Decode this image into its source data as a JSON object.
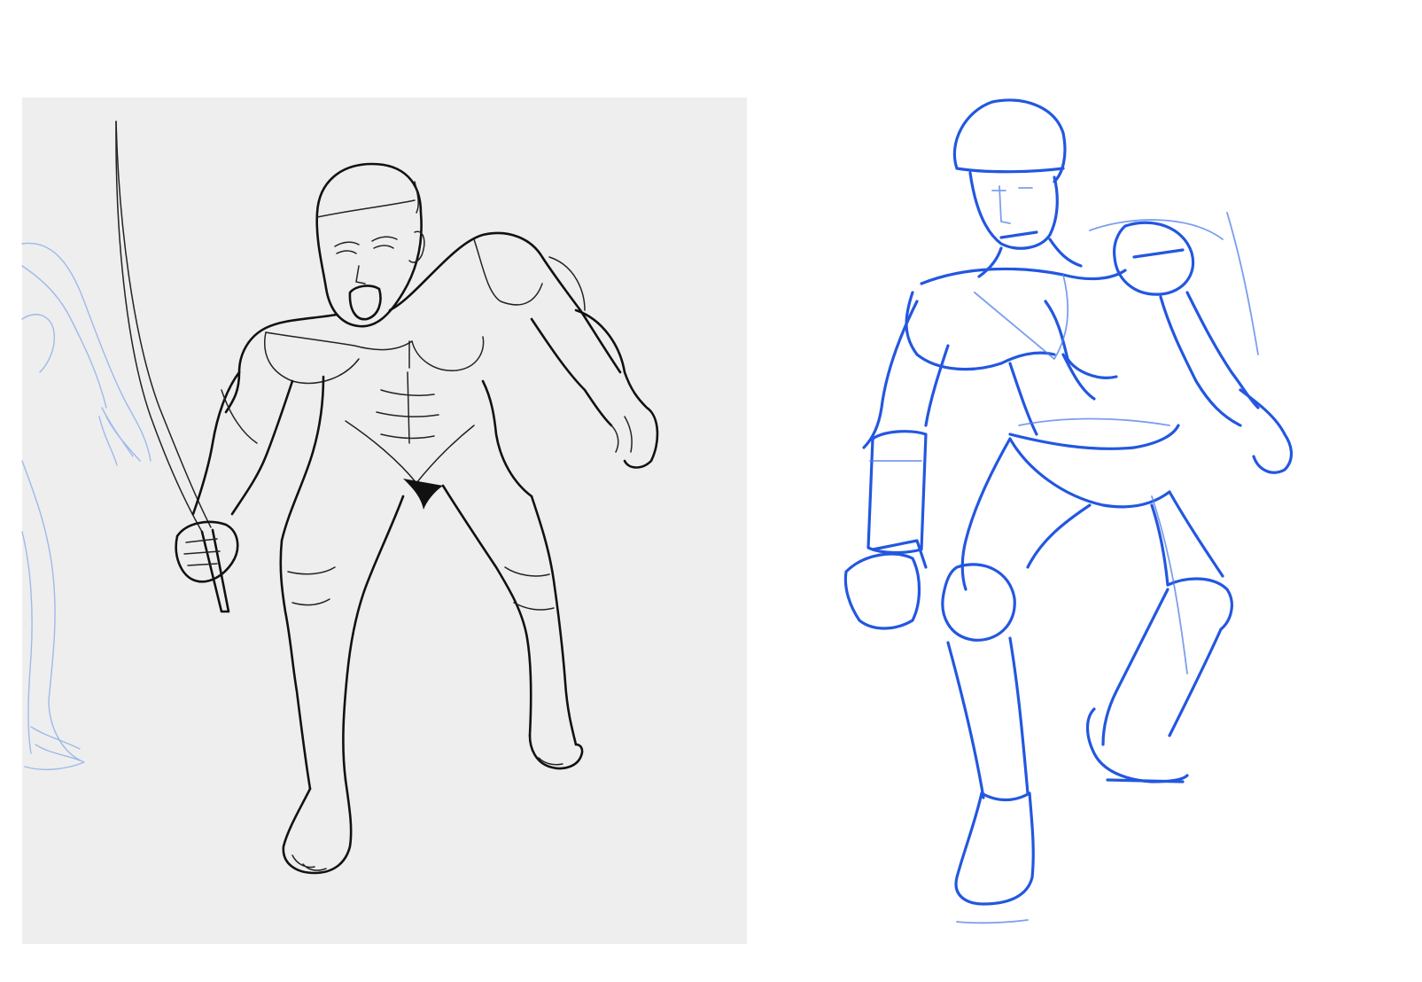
{
  "scene": {
    "background_color": "#ffffff",
    "panel_color": "#eeeeee",
    "ink_color": "#111111",
    "sketch_color": "#2357e0",
    "ghost_sketch_color": "#8fb0ea"
  },
  "left_panel": {
    "subject": "inked-figure-with-sword"
  },
  "right_panel": {
    "subject": "blue-construction-sketch"
  }
}
